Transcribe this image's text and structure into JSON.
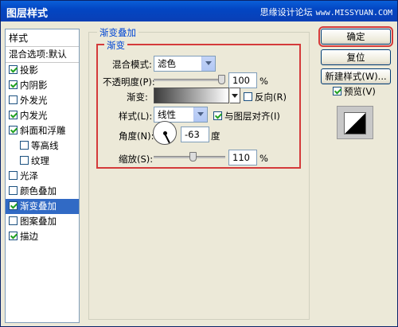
{
  "window": {
    "title": "图层样式",
    "watermark": "思缘设计论坛",
    "watermark_url": "www.MISSYUAN.COM"
  },
  "stylelist": {
    "header": "样式",
    "blend_options": "混合选项:默认",
    "items": [
      {
        "label": "投影",
        "checked": true,
        "sub": false
      },
      {
        "label": "内阴影",
        "checked": true,
        "sub": false
      },
      {
        "label": "外发光",
        "checked": false,
        "sub": false
      },
      {
        "label": "内发光",
        "checked": true,
        "sub": false
      },
      {
        "label": "斜面和浮雕",
        "checked": true,
        "sub": false
      },
      {
        "label": "等高线",
        "checked": false,
        "sub": true
      },
      {
        "label": "纹理",
        "checked": false,
        "sub": true
      },
      {
        "label": "光泽",
        "checked": false,
        "sub": false
      },
      {
        "label": "颜色叠加",
        "checked": false,
        "sub": false
      },
      {
        "label": "渐变叠加",
        "checked": true,
        "sub": false,
        "active": true
      },
      {
        "label": "图案叠加",
        "checked": false,
        "sub": false
      },
      {
        "label": "描边",
        "checked": true,
        "sub": false
      }
    ]
  },
  "panel": {
    "group_title": "渐变叠加",
    "sub_title": "渐变",
    "blend_mode_label": "混合模式:",
    "blend_mode_value": "滤色",
    "opacity_label": "不透明度(P):",
    "opacity_value": "100",
    "opacity_unit": "%",
    "opacity_level": 1.0,
    "gradient_label": "渐变:",
    "reverse_label": "反向(R)",
    "reverse_checked": false,
    "style_label": "样式(L):",
    "style_value": "线性",
    "align_label": "与图层对齐(I)",
    "align_checked": true,
    "angle_label": "角度(N):",
    "angle_value": "-63",
    "angle_unit": "度",
    "scale_label": "缩放(S):",
    "scale_value": "110",
    "scale_unit": "%",
    "scale_level": 0.55
  },
  "buttons": {
    "ok": "确定",
    "reset": "复位",
    "new_style": "新建样式(W)...",
    "preview": "预览(V)"
  },
  "colors": {
    "titlebar": "#0346c3",
    "highlight": "#d43a3a",
    "selection": "#316ac5",
    "legend_text": "#0046d5"
  }
}
